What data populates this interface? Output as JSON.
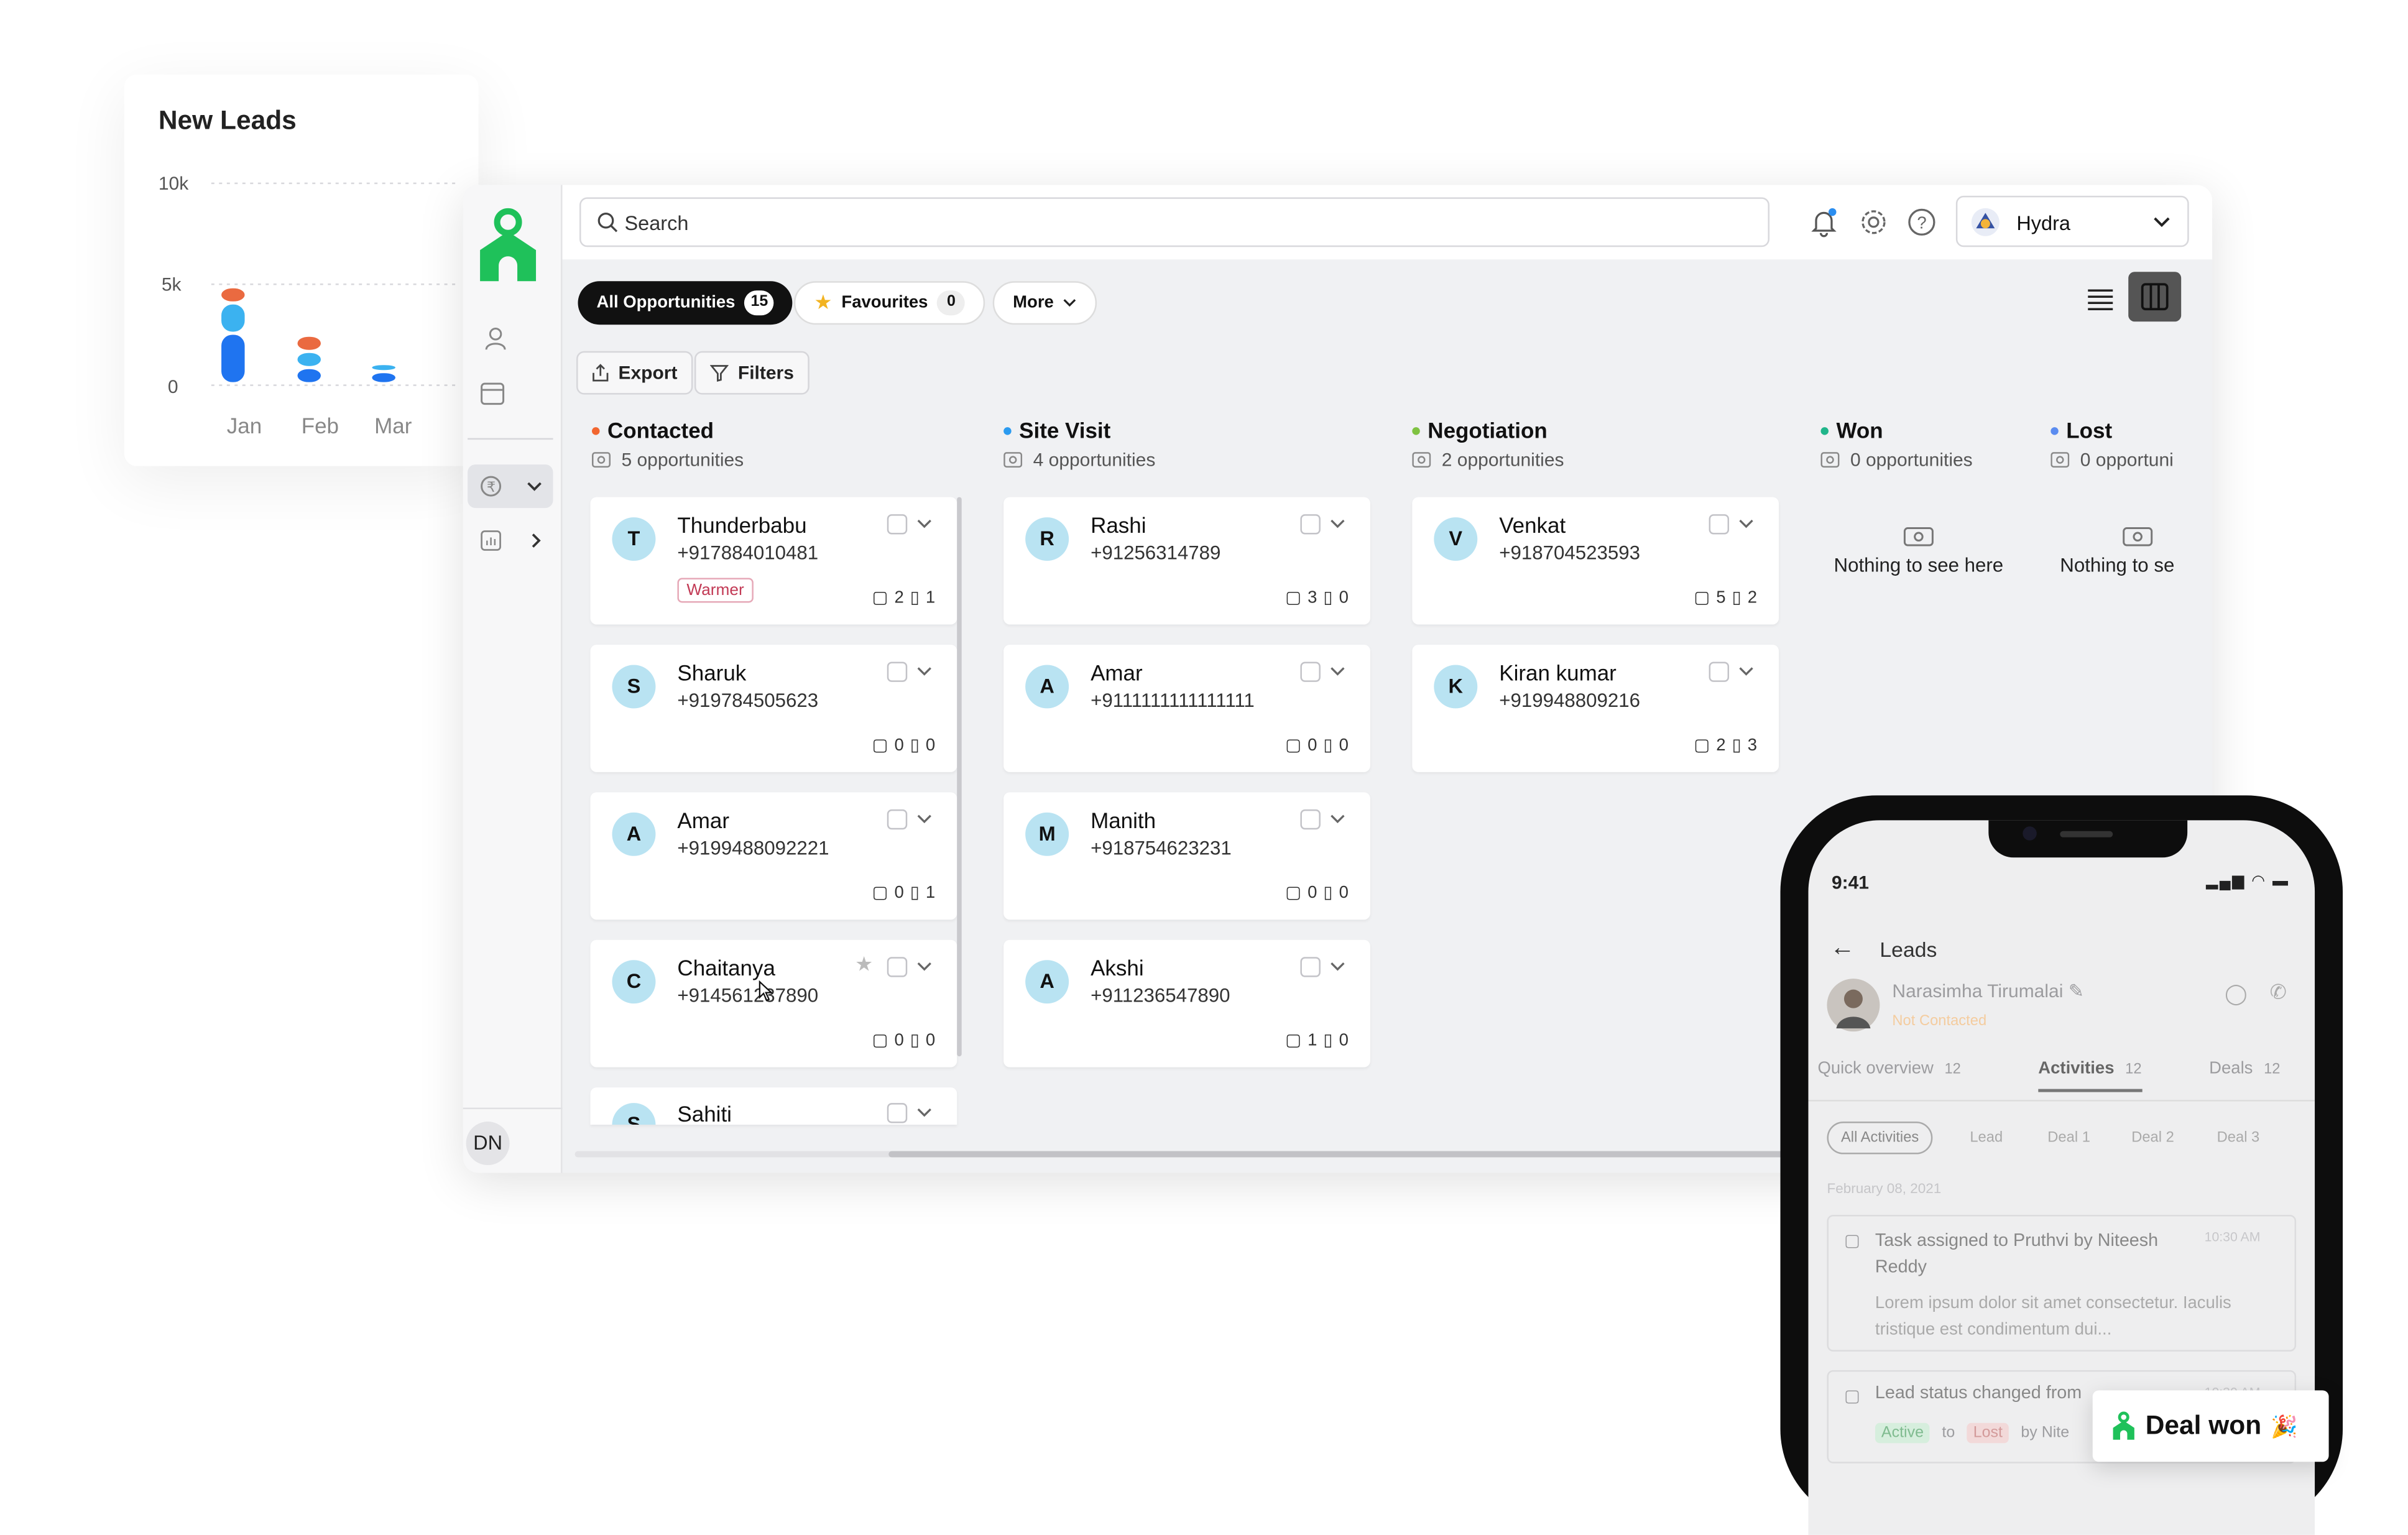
{
  "chart": {
    "title": "New Leads",
    "y_ticks": [
      "10k",
      "5k",
      "0"
    ],
    "x_ticks": [
      "Jan",
      "Feb",
      "Mar"
    ]
  },
  "chart_data": {
    "type": "bar",
    "title": "New Leads",
    "categories": [
      "Jan",
      "Feb",
      "Mar"
    ],
    "series": [
      {
        "values": [
          2500,
          800,
          600
        ],
        "color": "#1f74f0"
      },
      {
        "values": [
          1500,
          800,
          400
        ],
        "color": "#3bb2f0"
      },
      {
        "values": [
          800,
          800,
          0
        ],
        "color": "#ea6a40"
      }
    ],
    "ylim": [
      0,
      10000
    ],
    "grid": true,
    "stacked": true
  },
  "topbar": {
    "search_placeholder": "Search",
    "workspace": "Hydra"
  },
  "sidebar": {
    "user_initials": "DN",
    "icons": [
      "person-icon",
      "calendar-icon",
      "currency-icon",
      "chart-icon"
    ]
  },
  "filters": {
    "all_label": "All Opportunities",
    "all_count": "15",
    "fav_label": "Favourites",
    "fav_count": "0",
    "more_label": "More",
    "export_label": "Export",
    "filters_label": "Filters"
  },
  "columns": [
    {
      "title": "Contacted",
      "sub": "5 opportunities",
      "color": "#f2662f"
    },
    {
      "title": "Site Visit",
      "sub": "4 opportunities",
      "color": "#2b9bf0"
    },
    {
      "title": "Negotiation",
      "sub": "2 opportunities",
      "color": "#7fc241"
    },
    {
      "title": "Won",
      "sub": "0 opportunities",
      "color": "#20b58a"
    },
    {
      "title": "Lost",
      "sub": "0 opportuni",
      "color": "#5b8cf0"
    }
  ],
  "cards": {
    "contacted": [
      {
        "initial": "T",
        "name": "Thunderbabu",
        "phone": "+917884010481",
        "tag": "Warmer",
        "a": "2",
        "b": "1"
      },
      {
        "initial": "S",
        "name": "Sharuk",
        "phone": "+919784505623",
        "a": "0",
        "b": "0"
      },
      {
        "initial": "A",
        "name": "Amar",
        "phone": "+9199488092221",
        "a": "0",
        "b": "1"
      },
      {
        "initial": "C",
        "name": "Chaitanya",
        "phone": "+914561237890",
        "a": "0",
        "b": "0"
      },
      {
        "initial": "S",
        "name": "Sahiti"
      }
    ],
    "site_visit": [
      {
        "initial": "R",
        "name": "Rashi",
        "phone": "+91256314789",
        "a": "3",
        "b": "0"
      },
      {
        "initial": "A",
        "name": "Amar",
        "phone": "+9111111111111111",
        "a": "0",
        "b": "0"
      },
      {
        "initial": "M",
        "name": "Manith",
        "phone": "+918754623231",
        "a": "0",
        "b": "0"
      },
      {
        "initial": "A",
        "name": "Akshi",
        "phone": "+911236547890",
        "a": "1",
        "b": "0"
      }
    ],
    "negotiation": [
      {
        "initial": "V",
        "name": "Venkat",
        "phone": "+918704523593",
        "a": "5",
        "b": "2"
      },
      {
        "initial": "K",
        "name": "Kiran kumar",
        "phone": "+919948809216",
        "a": "2",
        "b": "3"
      }
    ]
  },
  "empty_text": "Nothing to see here",
  "empty_text_cut": "Nothing to se",
  "phone": {
    "time": "9:41",
    "header": "Leads",
    "contact_name": "Narasimha Tirumalai",
    "contact_status": "Not Contacted",
    "tabs": [
      {
        "label": "Quick overview",
        "count": "12"
      },
      {
        "label": "Activities",
        "count": "12"
      },
      {
        "label": "Deals",
        "count": "12"
      }
    ],
    "chips": [
      "All Activities",
      "Lead",
      "Deal 1",
      "Deal 2",
      "Deal 3"
    ],
    "date": "February 08, 2021",
    "activity1_title": "Task assigned to Pruthvi by Niteesh Reddy",
    "activity1_time": "10:30 AM",
    "activity1_body": "Lorem ipsum dolor sit amet consectetur. Iaculis tristique est condimentum dui...",
    "activity2_title": "Lead status changed from",
    "activity2_time": "10:30 AM",
    "activity2_from": "Active",
    "activity2_to_word": "to",
    "activity2_to": "Lost",
    "activity2_by": "by Nite"
  },
  "toast": {
    "label": "Deal won"
  }
}
